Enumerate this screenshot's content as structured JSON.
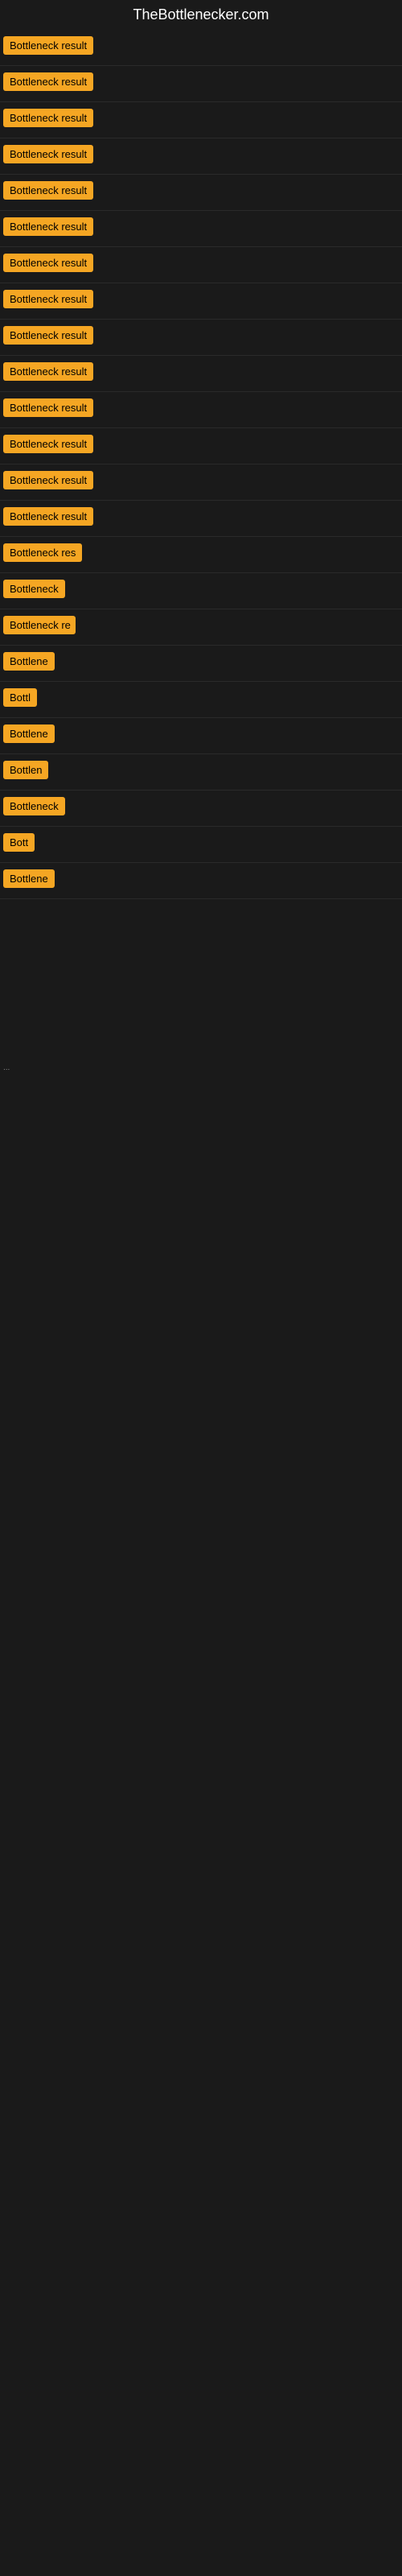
{
  "site": {
    "title": "TheBottlenecker.com"
  },
  "rows": [
    {
      "id": 1,
      "label": "Bottleneck result",
      "width": 130
    },
    {
      "id": 2,
      "label": "Bottleneck result",
      "width": 130
    },
    {
      "id": 3,
      "label": "Bottleneck result",
      "width": 130
    },
    {
      "id": 4,
      "label": "Bottleneck result",
      "width": 130
    },
    {
      "id": 5,
      "label": "Bottleneck result",
      "width": 130
    },
    {
      "id": 6,
      "label": "Bottleneck result",
      "width": 130
    },
    {
      "id": 7,
      "label": "Bottleneck result",
      "width": 130
    },
    {
      "id": 8,
      "label": "Bottleneck result",
      "width": 130
    },
    {
      "id": 9,
      "label": "Bottleneck result",
      "width": 130
    },
    {
      "id": 10,
      "label": "Bottleneck result",
      "width": 130
    },
    {
      "id": 11,
      "label": "Bottleneck result",
      "width": 130
    },
    {
      "id": 12,
      "label": "Bottleneck result",
      "width": 130
    },
    {
      "id": 13,
      "label": "Bottleneck result",
      "width": 130
    },
    {
      "id": 14,
      "label": "Bottleneck result",
      "width": 130
    },
    {
      "id": 15,
      "label": "Bottleneck res",
      "width": 110
    },
    {
      "id": 16,
      "label": "Bottleneck",
      "width": 78
    },
    {
      "id": 17,
      "label": "Bottleneck re",
      "width": 90
    },
    {
      "id": 18,
      "label": "Bottlene",
      "width": 65
    },
    {
      "id": 19,
      "label": "Bottl",
      "width": 48
    },
    {
      "id": 20,
      "label": "Bottlene",
      "width": 65
    },
    {
      "id": 21,
      "label": "Bottlen",
      "width": 58
    },
    {
      "id": 22,
      "label": "Bottleneck",
      "width": 78
    },
    {
      "id": 23,
      "label": "Bott",
      "width": 40
    },
    {
      "id": 24,
      "label": "Bottlene",
      "width": 65
    }
  ],
  "dots": "..."
}
